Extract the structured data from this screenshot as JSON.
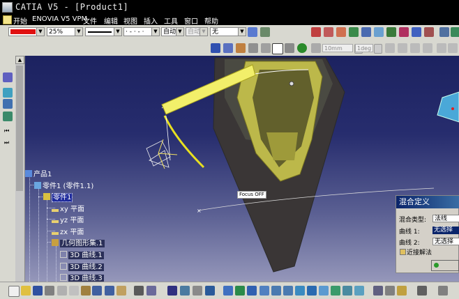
{
  "window": {
    "title": "CATIA V5 - [Product1]"
  },
  "menu": {
    "start": "开始",
    "items": [
      "ENOVIA V5 VPM",
      "文件",
      "编辑",
      "视图",
      "插入",
      "工具",
      "窗口",
      "帮助"
    ]
  },
  "properties_toolbar": {
    "color": "#e01010",
    "transparency": "25%",
    "line_type": "· - · - ·",
    "linewidth_mode": "自动",
    "layer_mode": "自动",
    "layer": "无"
  },
  "toolbar2": {
    "length_field": "10mm",
    "angle_field": "1deg"
  },
  "tree": {
    "root": "产品1",
    "part_instance": "零件1 (零件1.1)",
    "part": "零件1",
    "planes": [
      "xy 平面",
      "yz 平面",
      "zx 平面"
    ],
    "geometric_set": "几何图形集.1",
    "curves": [
      "3D 曲线.1",
      "3D 曲线.2",
      "3D 曲线.3"
    ]
  },
  "viewport": {
    "focus_label": "Focus OFF"
  },
  "dialog": {
    "title": "混合定义",
    "blend_type_label": "混合类型:",
    "blend_type_value": "法线",
    "curve1_label": "曲线 1:",
    "curve1_value": "无选择",
    "curve2_label": "曲线 2:",
    "curve2_value": "无选择",
    "approx_label": "近接解法"
  }
}
